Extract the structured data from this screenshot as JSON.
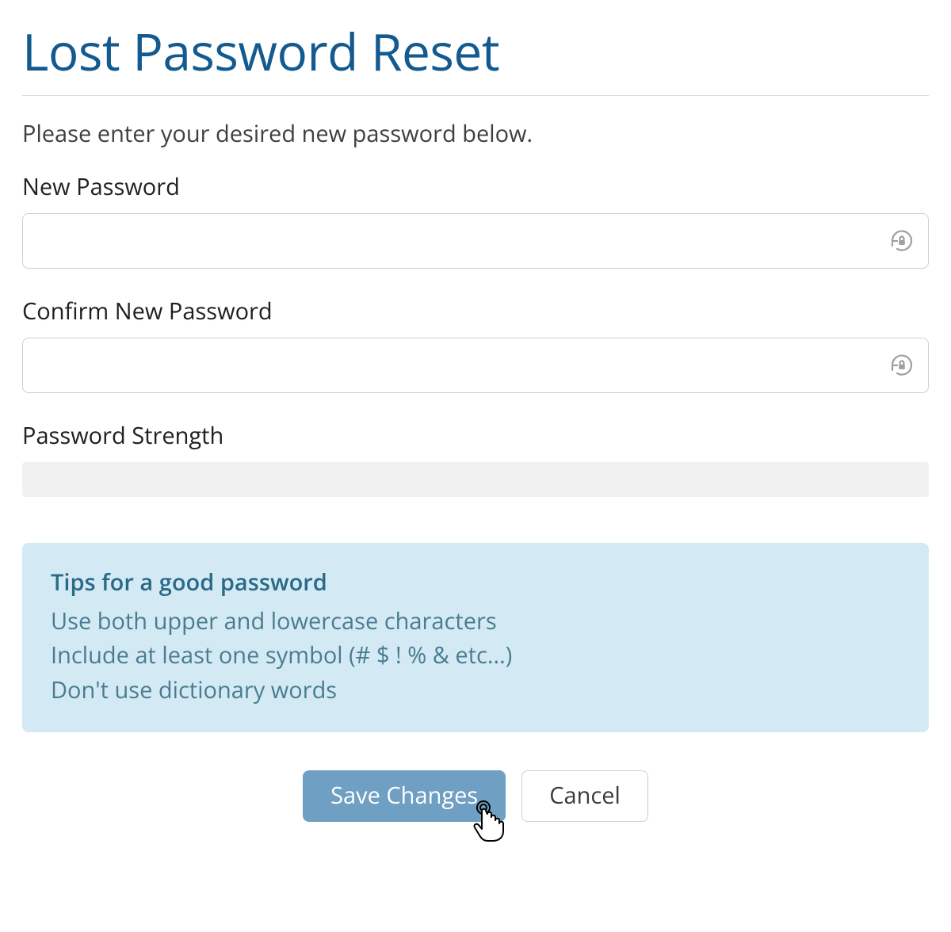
{
  "title": "Lost Password Reset",
  "intro": "Please enter your desired new password below.",
  "form": {
    "new_password": {
      "label": "New Password",
      "value": "",
      "placeholder": ""
    },
    "confirm_password": {
      "label": "Confirm New Password",
      "value": "",
      "placeholder": ""
    },
    "strength": {
      "label": "Password Strength"
    }
  },
  "tips": {
    "title": "Tips for a good password",
    "lines": [
      "Use both upper and lowercase characters",
      "Include at least one symbol (# $ ! % & etc...)",
      "Don't use dictionary words"
    ]
  },
  "buttons": {
    "save": "Save Changes",
    "cancel": "Cancel"
  }
}
